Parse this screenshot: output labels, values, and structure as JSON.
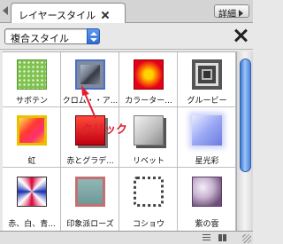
{
  "tab": {
    "title": "レイヤースタイル",
    "detail_label": "詳細"
  },
  "preset_select": {
    "value": "複合スタイル"
  },
  "styles": [
    {
      "label": "サボテン"
    },
    {
      "label": "クロム・・ア..."
    },
    {
      "label": "カラーター..."
    },
    {
      "label": "グルービー"
    },
    {
      "label": "虹"
    },
    {
      "label": "赤とグラデ..."
    },
    {
      "label": "リベット"
    },
    {
      "label": "星光彩"
    },
    {
      "label": "赤、白、青..."
    },
    {
      "label": "印象派ローズ"
    },
    {
      "label": "コショウ"
    },
    {
      "label": "紫の雲"
    }
  ],
  "annotation": {
    "text": "クリック",
    "color": "#e02030"
  },
  "icons": {
    "tab_scroll": "triangle-left-icon",
    "tab_close": "close-icon",
    "close": "x-icon",
    "list_view": "list-view-icon",
    "thumb_view": "thumbnail-view-icon"
  }
}
